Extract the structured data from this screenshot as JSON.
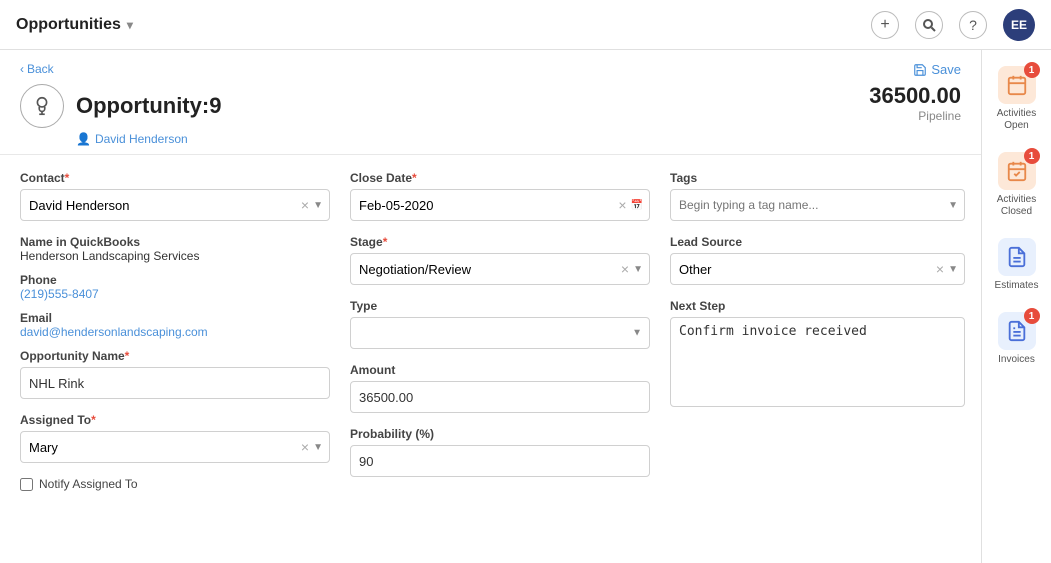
{
  "topnav": {
    "title": "Opportunities",
    "chevron": "▾",
    "icons": {
      "plus": "+",
      "search": "🔍",
      "help": "?"
    },
    "avatar": "EE"
  },
  "header": {
    "back_label": "Back",
    "save_label": "Save",
    "opp_title": "Opportunity:9",
    "amount": "36500.00",
    "pipeline": "Pipeline",
    "assigned_name": "David  Henderson"
  },
  "form": {
    "contact_label": "Contact",
    "contact_value": "David Henderson",
    "close_date_label": "Close Date",
    "close_date_value": "Feb-05-2020",
    "tags_label": "Tags",
    "tags_placeholder": "Begin typing a tag name...",
    "name_in_qb_label": "Name in QuickBooks",
    "name_in_qb_value": "Henderson Landscaping Services",
    "stage_label": "Stage",
    "stage_value": "Negotiation/Review",
    "lead_source_label": "Lead Source",
    "lead_source_value": "Other",
    "phone_label": "Phone",
    "phone_value": "(219)555-8407",
    "email_label": "Email",
    "email_value": "david@hendersonlandscaping.com",
    "type_label": "Type",
    "type_value": "",
    "next_step_label": "Next Step",
    "next_step_value": "Confirm invoice received",
    "opp_name_label": "Opportunity Name",
    "opp_name_value": "NHL Rink",
    "amount_label": "Amount",
    "amount_value": "36500.00",
    "assigned_to_label": "Assigned To",
    "assigned_to_value": "Mary",
    "probability_label": "Probability (%)",
    "probability_value": "90",
    "notify_label": "Notify Assigned To"
  },
  "sidebar": {
    "items": [
      {
        "label": "Activities Open",
        "badge": "1",
        "icon": "calendar"
      },
      {
        "label": "Activities Closed",
        "badge": "1",
        "icon": "calendar-check"
      },
      {
        "label": "Estimates",
        "badge": "",
        "icon": "file"
      },
      {
        "label": "Invoices",
        "badge": "1",
        "icon": "invoice"
      }
    ]
  }
}
